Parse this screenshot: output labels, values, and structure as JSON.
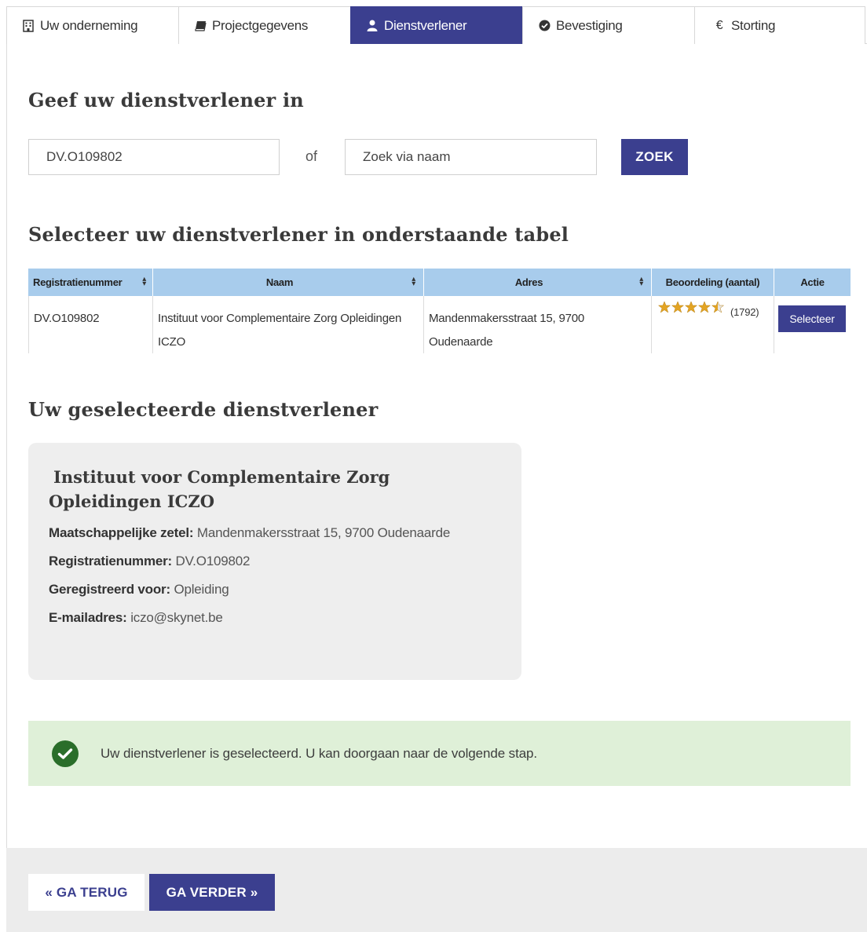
{
  "tabs": [
    {
      "label": "Uw onderneming",
      "icon": "building-icon",
      "active": false
    },
    {
      "label": "Projectgegevens",
      "icon": "book-icon",
      "active": false
    },
    {
      "label": "Dienstverlener",
      "icon": "user-icon",
      "active": true
    },
    {
      "label": "Bevestiging",
      "icon": "check-circle-icon",
      "active": false
    },
    {
      "label": "Storting",
      "icon": "euro-icon",
      "active": false
    }
  ],
  "search": {
    "heading": "Geef uw dienstverlener in",
    "registration_value": "DV.O109802",
    "or_label": "of",
    "name_placeholder": "Zoek via naam",
    "button_label": "ZOEK"
  },
  "table": {
    "heading": "Selecteer uw dienstverlener in onderstaande tabel",
    "columns": [
      "Registratienummer",
      "Naam",
      "Adres",
      "Beoordeling (aantal)",
      "Actie"
    ],
    "rows": [
      {
        "registratienummer": "DV.O109802",
        "naam": "Instituut voor Complementaire Zorg Opleidingen ICZO",
        "adres": "Mandenmakersstraat 15, 9700 Oudenaarde",
        "rating": 4.5,
        "rating_count": "(1792)",
        "action_label": "Selecteer"
      }
    ]
  },
  "selected": {
    "heading": "Uw geselecteerde dienstverlener",
    "name_line1": "Instituut voor Complementaire Zorg",
    "name_line2": "Opleidingen ICZO",
    "zetel_label": "Maatschappelijke zetel:",
    "zetel_value": "Mandenmakersstraat 15, 9700 Oudenaarde",
    "reg_label": "Registratienummer:",
    "reg_value": "DV.O109802",
    "registered_label": "Geregistreerd voor:",
    "registered_value": "Opleiding",
    "email_label": "E-mailadres:",
    "email_value": "iczo@skynet.be"
  },
  "alert": {
    "message": "Uw dienstverlener is geselecteerd. U kan doorgaan naar de volgende stap.",
    "color": "#dff0d8"
  },
  "footer": {
    "back_label": "« GA TERUG",
    "next_label": "GA VERDER »"
  },
  "colors": {
    "primary": "#3b3f8f",
    "table_header": "#a8ccec",
    "star": "#e3a423"
  }
}
